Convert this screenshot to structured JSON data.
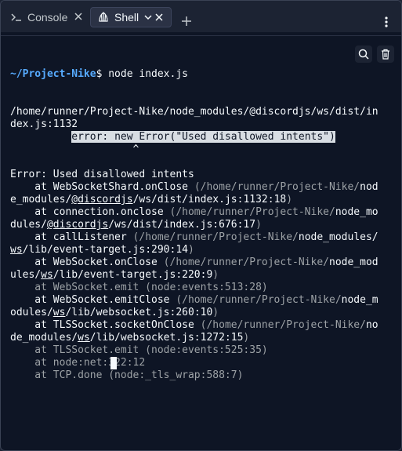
{
  "tabs": [
    {
      "label": "Console",
      "icon": "terminal-prompt-icon",
      "active": false
    },
    {
      "label": "Shell",
      "icon": "shell-icon",
      "active": true
    }
  ],
  "toolbar": {
    "search_icon": "search-icon",
    "delete_icon": "trash-icon"
  },
  "terminal": {
    "prompt_path": "~/Project-Nike",
    "prompt_symbol": "$",
    "command": " node index.js",
    "lines": [
      {
        "segments": [
          {
            "t": "/home/runner/Project-Nike/node_modules/@discordjs/ws/dist/in"
          }
        ]
      },
      {
        "segments": [
          {
            "t": "dex.js:1132"
          }
        ]
      },
      {
        "segments": [
          {
            "t": "          "
          },
          {
            "t": "error: new Error(\"Used disallowed intents\")",
            "c": "hl"
          }
        ]
      },
      {
        "segments": [
          {
            "t": "                    ^"
          }
        ]
      },
      {
        "segments": []
      },
      {
        "segments": [
          {
            "t": "Error: Used disallowed intents"
          }
        ]
      },
      {
        "segments": [
          {
            "t": "    at WebSocketShard.onClose "
          },
          {
            "t": "(/home/runner/Project-Nike/",
            "c": "dim"
          },
          {
            "t": "nod"
          }
        ]
      },
      {
        "segments": [
          {
            "t": "e_modules/"
          },
          {
            "t": "@discordjs",
            "c": "ul"
          },
          {
            "t": "/ws/dist/index.js:1132:18"
          },
          {
            "t": ")",
            "c": "dim"
          }
        ]
      },
      {
        "segments": [
          {
            "t": "    at connection.onclose "
          },
          {
            "t": "(/home/runner/Project-Nike/",
            "c": "dim"
          },
          {
            "t": "node_mo"
          }
        ]
      },
      {
        "segments": [
          {
            "t": "dules/"
          },
          {
            "t": "@discordjs",
            "c": "ul"
          },
          {
            "t": "/ws/dist/index.js:676:17"
          },
          {
            "t": ")",
            "c": "dim"
          }
        ]
      },
      {
        "segments": [
          {
            "t": "    at callListener "
          },
          {
            "t": "(/home/runner/Project-Nike/",
            "c": "dim"
          },
          {
            "t": "node_modules/"
          }
        ]
      },
      {
        "segments": [
          {
            "t": "ws",
            "c": "ul"
          },
          {
            "t": "/lib/event-target.js:290:14"
          },
          {
            "t": ")",
            "c": "dim"
          }
        ]
      },
      {
        "segments": [
          {
            "t": "    at WebSocket.onClose "
          },
          {
            "t": "(/home/runner/Project-Nike/",
            "c": "dim"
          },
          {
            "t": "node_mod"
          }
        ]
      },
      {
        "segments": [
          {
            "t": "ules/"
          },
          {
            "t": "ws",
            "c": "ul"
          },
          {
            "t": "/lib/event-target.js:220:9"
          },
          {
            "t": ")",
            "c": "dim"
          }
        ]
      },
      {
        "segments": [
          {
            "t": "    at WebSocket.emit (node:events:513:28)",
            "c": "dim"
          }
        ]
      },
      {
        "segments": [
          {
            "t": "    at WebSocket.emitClose "
          },
          {
            "t": "(/home/runner/Project-Nike/",
            "c": "dim"
          },
          {
            "t": "node_m"
          }
        ]
      },
      {
        "segments": [
          {
            "t": "odules/"
          },
          {
            "t": "ws",
            "c": "ul"
          },
          {
            "t": "/lib/websocket.js:260:10"
          },
          {
            "t": ")",
            "c": "dim"
          }
        ]
      },
      {
        "segments": [
          {
            "t": "    at TLSSocket.socketOnClose "
          },
          {
            "t": "(/home/runner/Project-Nike/",
            "c": "dim"
          },
          {
            "t": "no"
          }
        ]
      },
      {
        "segments": [
          {
            "t": "de_modules/"
          },
          {
            "t": "ws",
            "c": "ul"
          },
          {
            "t": "/lib/websocket.js:1272:15"
          },
          {
            "t": ")",
            "c": "dim"
          }
        ]
      },
      {
        "segments": [
          {
            "t": "    at TLSSocket.emit (node:events:525:35)",
            "c": "dim"
          }
        ]
      },
      {
        "segments": [
          {
            "t": "    at node:net:322:12",
            "c": "dim"
          }
        ]
      },
      {
        "segments": [
          {
            "t": "    at TCP.done (node:_tls_wrap:588:7)",
            "c": "dim"
          }
        ]
      }
    ]
  }
}
